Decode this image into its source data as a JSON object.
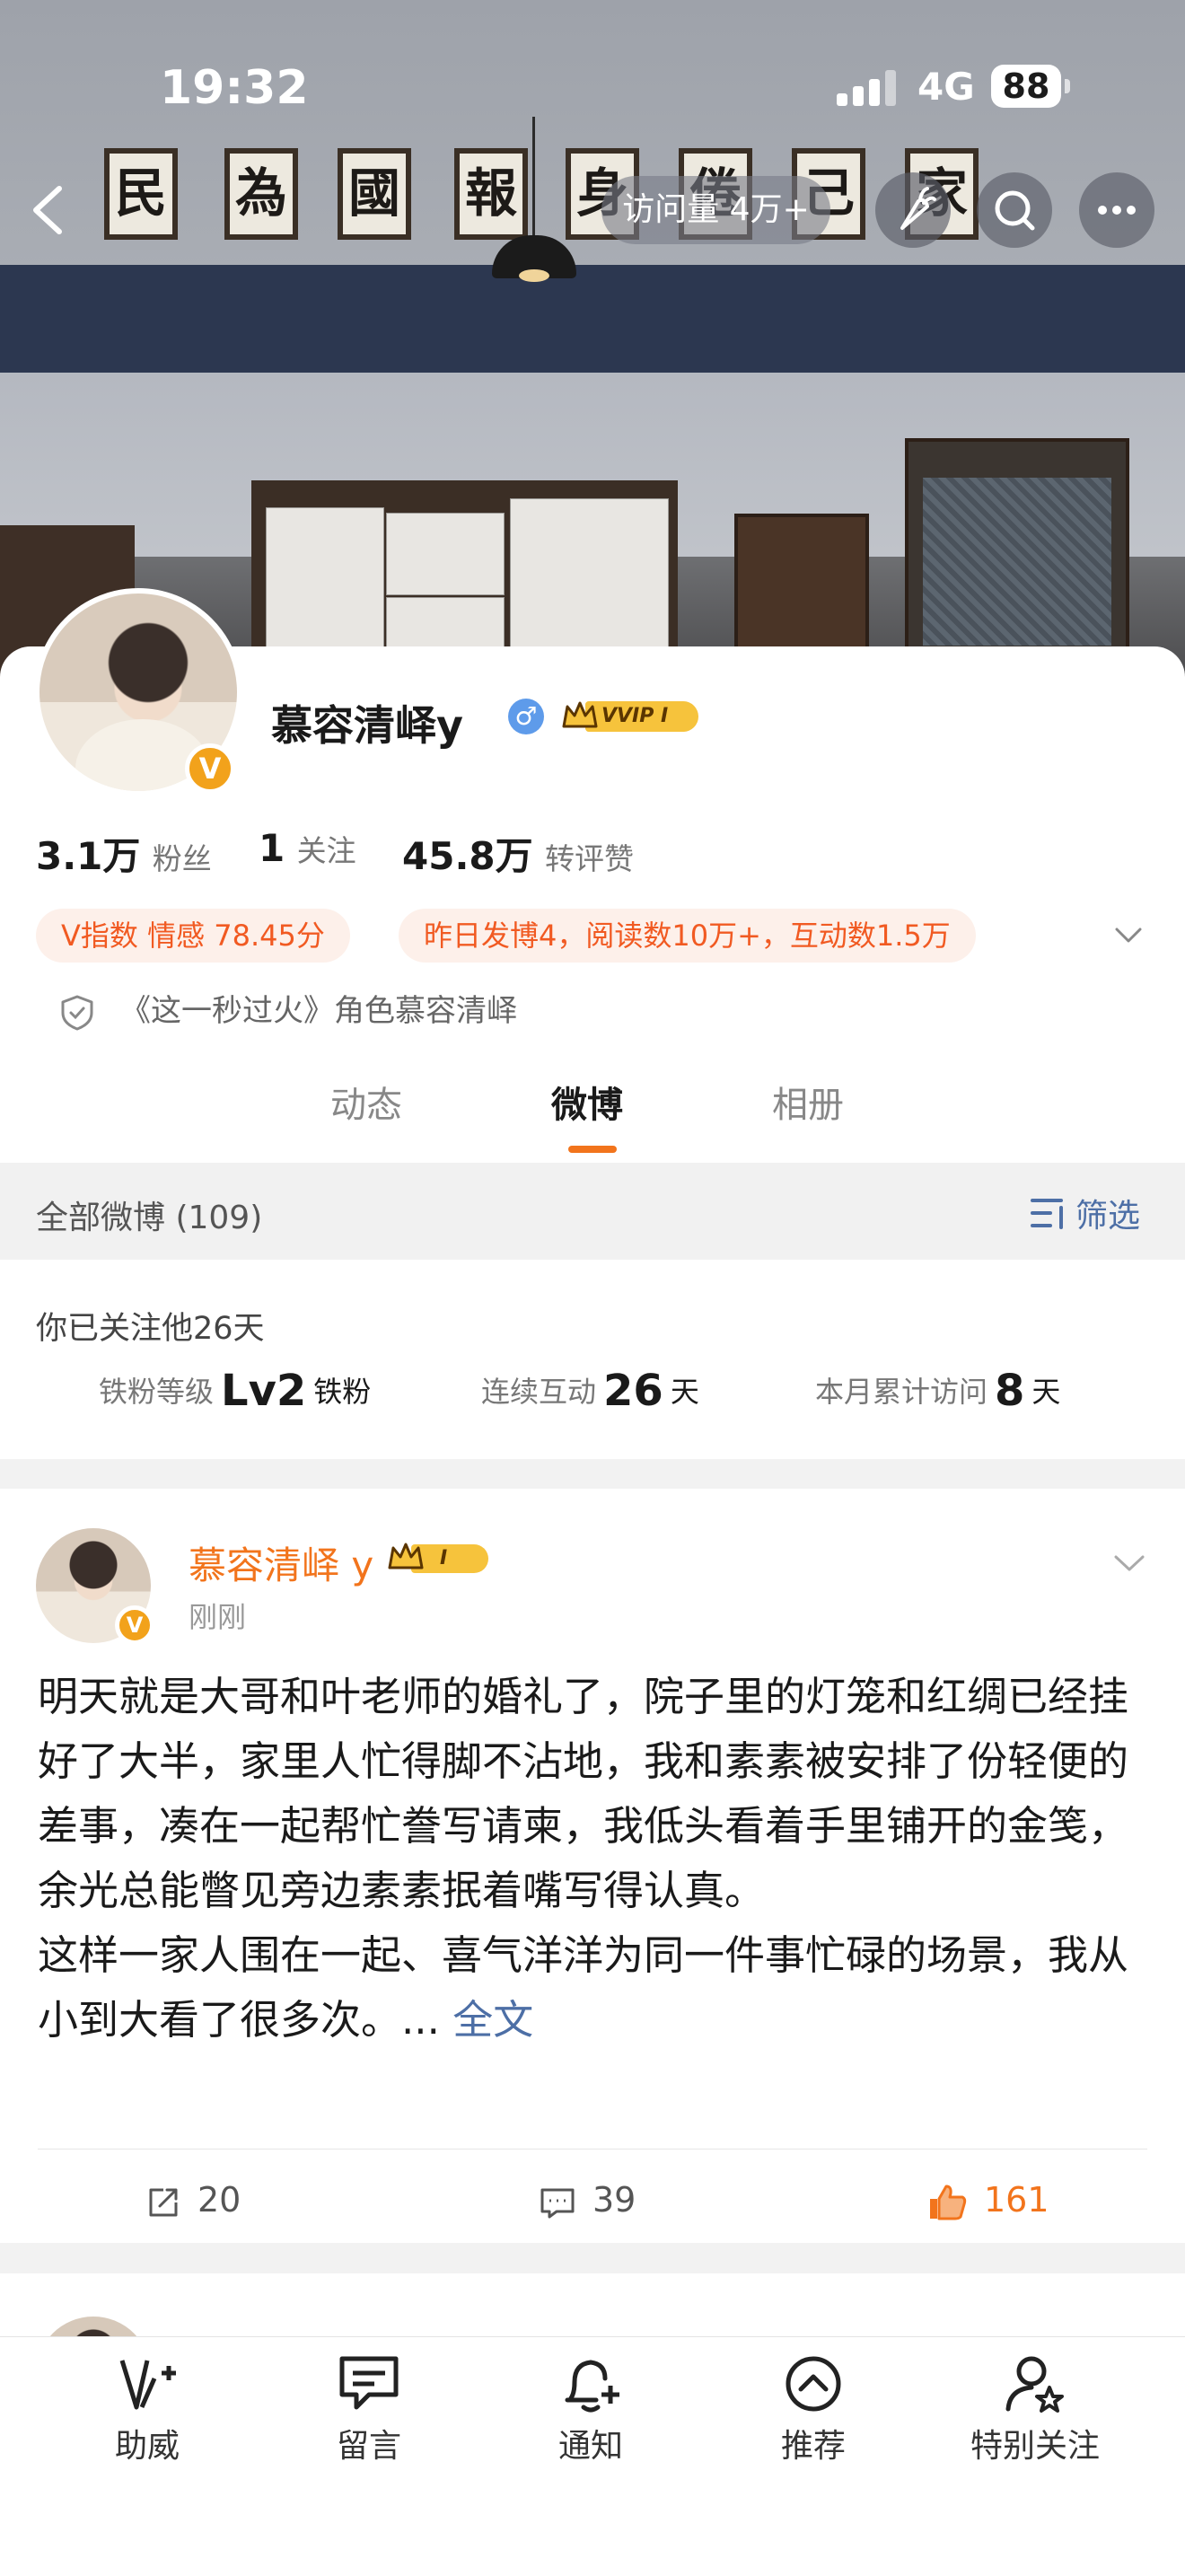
{
  "status_bar": {
    "time": "19:32",
    "network": "4G",
    "battery": "88"
  },
  "cover": {
    "plaques": [
      "民",
      "為",
      "國",
      "報",
      "身",
      "倦",
      "己",
      "家"
    ]
  },
  "top_nav": {
    "visits": "访问量 4万+"
  },
  "profile": {
    "username": "慕容清峄y",
    "gender_symbol": "♂",
    "vip_label": "VVIP I",
    "verified_badge": "V",
    "stats": [
      {
        "value": "3.1万",
        "label": "粉丝"
      },
      {
        "value": "1",
        "label": "关注"
      },
      {
        "value": "45.8万",
        "label": "转评赞"
      }
    ],
    "chips": [
      "V指数  情感 78.45分",
      "昨日发博4，阅读数10万+，互动数1.5万"
    ],
    "tag": "《这一秒过火》角色慕容清峄"
  },
  "tabs": [
    "动态",
    "微博",
    "相册"
  ],
  "filter": {
    "all_label": "全部微博 (109)",
    "filter_label": "筛选"
  },
  "fan_card": {
    "follow_text": "你已关注他26天",
    "items": [
      {
        "label": "铁粉等级",
        "value": "Lv2",
        "unit": "铁粉"
      },
      {
        "label": "连续互动",
        "value": "26",
        "unit": "天"
      },
      {
        "label": "本月累计访问",
        "value": "8",
        "unit": "天"
      }
    ]
  },
  "post": {
    "name": "慕容清峄 y",
    "vip_label": "I",
    "time": "刚刚",
    "text": "明天就是大哥和叶老师的婚礼了，院子里的灯笼和红绸已经挂好了大半，家里人忙得脚不沾地，我和素素被安排了份轻便的差事，凑在一起帮忙誊写请柬，我低头看着手里铺开的金笺，余光总能瞥见旁边素素抿着嘴写得认真。\n这样一家人围在一起、喜气洋洋为同一件事忙碌的场景，我从小到大看了很多次。... ",
    "full_text_link": "全文",
    "reposts": "20",
    "comments": "39",
    "likes": "161"
  },
  "bottom_tabs": [
    "助威",
    "留言",
    "通知",
    "推荐",
    "特别关注"
  ],
  "colors": {
    "accent": "#f2741c",
    "link": "#4d6fa6",
    "gold": "#f6c33c"
  }
}
